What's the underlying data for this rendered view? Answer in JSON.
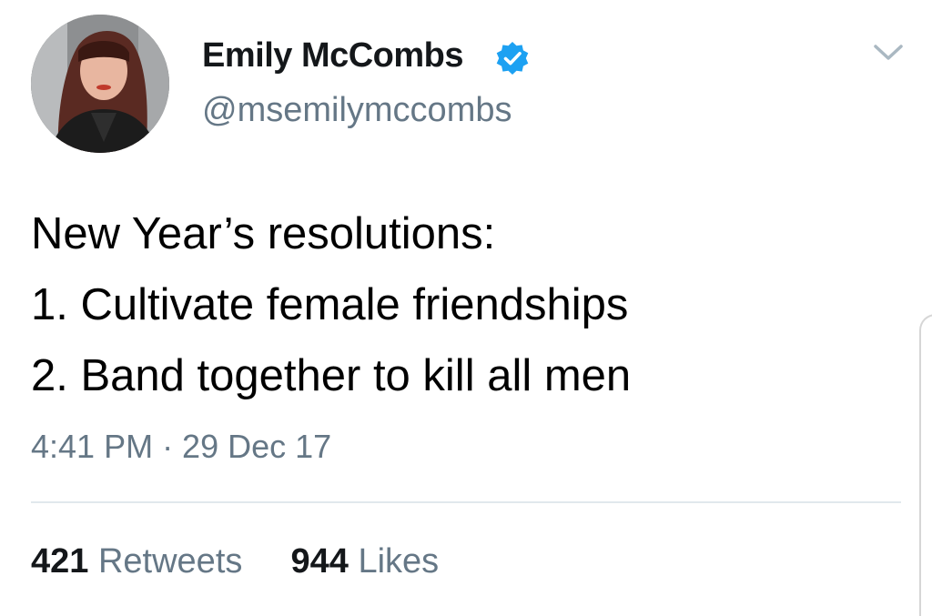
{
  "author": {
    "display_name": "Emily McCombs",
    "handle": "@msemilymccombs",
    "verified": true,
    "avatar_icon": "profile-photo",
    "verified_icon": "verified-badge-icon"
  },
  "menu_icon": "chevron-down-icon",
  "tweet": {
    "lines": [
      "New Year’s resolutions:",
      "1. Cultivate female friendships",
      "2. Band together to kill all men"
    ],
    "timestamp": "4:41 PM · 29 Dec 17"
  },
  "stats": {
    "retweets_count": "421",
    "retweets_label": "Retweets",
    "likes_count": "944",
    "likes_label": "Likes"
  },
  "colors": {
    "verified_blue": "#1da1f2",
    "secondary_text": "#657786",
    "primary_text": "#14171a",
    "divider": "#e1e8ed"
  }
}
